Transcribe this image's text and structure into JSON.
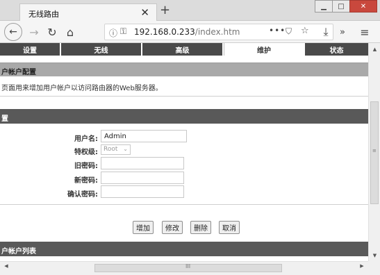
{
  "browser": {
    "tab_title": "无线路由",
    "tab_close": "✕",
    "new_tab": "+",
    "url_host": "192.168.0.233",
    "url_path": "/index.htm",
    "url_more": "•••",
    "window_controls": {
      "minimize": "▁",
      "maximize": "□",
      "close": "✕"
    }
  },
  "topnav": {
    "items": [
      {
        "label": "设置"
      },
      {
        "label": "无线"
      },
      {
        "label": "高级"
      },
      {
        "label": "维护"
      },
      {
        "label": "状态"
      }
    ],
    "active": "维护"
  },
  "page": {
    "section_title": "户帐户配置",
    "description": "页面用来增加用户帐户以访问路由器的Web服务器。",
    "form_section_title": "置",
    "list_section_title": "户帐户列表"
  },
  "form": {
    "username_label": "用户名:",
    "username_value": "Admin",
    "privilege_label": "特权级:",
    "privilege_value": "Root",
    "old_password_label": "旧密码:",
    "new_password_label": "新密码:",
    "confirm_password_label": "确认密码:"
  },
  "buttons": {
    "add": "增加",
    "modify": "修改",
    "delete": "删除",
    "cancel": "取消"
  },
  "scrollbar": {
    "grip_v": "≡",
    "grip_h": "III"
  }
}
